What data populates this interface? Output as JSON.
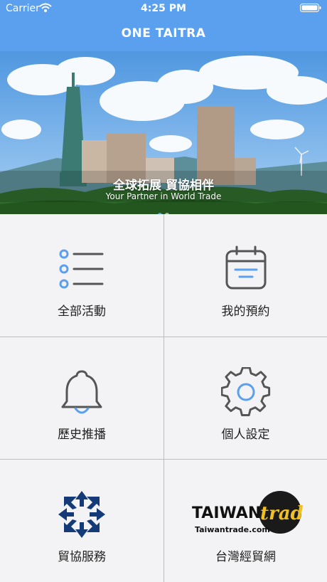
{
  "status_bar": {
    "carrier": "Carrier",
    "time": "4:25 PM"
  },
  "nav": {
    "title": "ONE TAITRA"
  },
  "banner": {
    "headline": "全球拓展 貿協相伴",
    "subline": "Your Partner in World Trade",
    "page_count": 2,
    "active_page": 0
  },
  "menu": [
    {
      "label": "全部活動",
      "icon": "list-icon"
    },
    {
      "label": "我的預約",
      "icon": "calendar-icon"
    },
    {
      "label": "歷史推播",
      "icon": "bell-icon"
    },
    {
      "label": "個人設定",
      "icon": "gear-icon"
    },
    {
      "label": "貿協服務",
      "icon": "taitra-logo-icon"
    },
    {
      "label": "台灣經貿網",
      "icon": "taiwantrade-logo-icon",
      "logo_text": "TAIWANtrade",
      "logo_url": "Taiwantrade.com"
    }
  ],
  "colors": {
    "accent": "#5aa0ee",
    "navy": "#143a78",
    "icon_gray": "#555555"
  }
}
